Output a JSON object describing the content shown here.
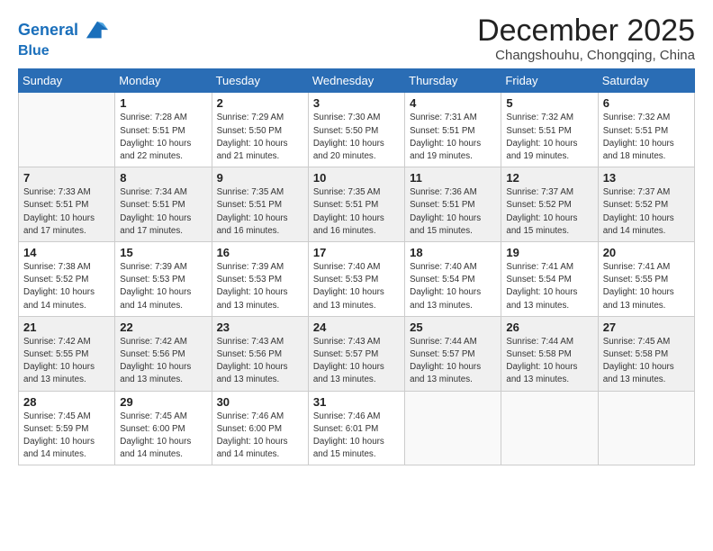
{
  "header": {
    "logo_line1": "General",
    "logo_line2": "Blue",
    "month_title": "December 2025",
    "location": "Changshouhu, Chongqing, China"
  },
  "weekdays": [
    "Sunday",
    "Monday",
    "Tuesday",
    "Wednesday",
    "Thursday",
    "Friday",
    "Saturday"
  ],
  "weeks": [
    [
      {
        "day": "",
        "sunrise": "",
        "sunset": "",
        "daylight": ""
      },
      {
        "day": "1",
        "sunrise": "Sunrise: 7:28 AM",
        "sunset": "Sunset: 5:51 PM",
        "daylight": "Daylight: 10 hours and 22 minutes."
      },
      {
        "day": "2",
        "sunrise": "Sunrise: 7:29 AM",
        "sunset": "Sunset: 5:50 PM",
        "daylight": "Daylight: 10 hours and 21 minutes."
      },
      {
        "day": "3",
        "sunrise": "Sunrise: 7:30 AM",
        "sunset": "Sunset: 5:50 PM",
        "daylight": "Daylight: 10 hours and 20 minutes."
      },
      {
        "day": "4",
        "sunrise": "Sunrise: 7:31 AM",
        "sunset": "Sunset: 5:51 PM",
        "daylight": "Daylight: 10 hours and 19 minutes."
      },
      {
        "day": "5",
        "sunrise": "Sunrise: 7:32 AM",
        "sunset": "Sunset: 5:51 PM",
        "daylight": "Daylight: 10 hours and 19 minutes."
      },
      {
        "day": "6",
        "sunrise": "Sunrise: 7:32 AM",
        "sunset": "Sunset: 5:51 PM",
        "daylight": "Daylight: 10 hours and 18 minutes."
      }
    ],
    [
      {
        "day": "7",
        "sunrise": "Sunrise: 7:33 AM",
        "sunset": "Sunset: 5:51 PM",
        "daylight": "Daylight: 10 hours and 17 minutes."
      },
      {
        "day": "8",
        "sunrise": "Sunrise: 7:34 AM",
        "sunset": "Sunset: 5:51 PM",
        "daylight": "Daylight: 10 hours and 17 minutes."
      },
      {
        "day": "9",
        "sunrise": "Sunrise: 7:35 AM",
        "sunset": "Sunset: 5:51 PM",
        "daylight": "Daylight: 10 hours and 16 minutes."
      },
      {
        "day": "10",
        "sunrise": "Sunrise: 7:35 AM",
        "sunset": "Sunset: 5:51 PM",
        "daylight": "Daylight: 10 hours and 16 minutes."
      },
      {
        "day": "11",
        "sunrise": "Sunrise: 7:36 AM",
        "sunset": "Sunset: 5:51 PM",
        "daylight": "Daylight: 10 hours and 15 minutes."
      },
      {
        "day": "12",
        "sunrise": "Sunrise: 7:37 AM",
        "sunset": "Sunset: 5:52 PM",
        "daylight": "Daylight: 10 hours and 15 minutes."
      },
      {
        "day": "13",
        "sunrise": "Sunrise: 7:37 AM",
        "sunset": "Sunset: 5:52 PM",
        "daylight": "Daylight: 10 hours and 14 minutes."
      }
    ],
    [
      {
        "day": "14",
        "sunrise": "Sunrise: 7:38 AM",
        "sunset": "Sunset: 5:52 PM",
        "daylight": "Daylight: 10 hours and 14 minutes."
      },
      {
        "day": "15",
        "sunrise": "Sunrise: 7:39 AM",
        "sunset": "Sunset: 5:53 PM",
        "daylight": "Daylight: 10 hours and 14 minutes."
      },
      {
        "day": "16",
        "sunrise": "Sunrise: 7:39 AM",
        "sunset": "Sunset: 5:53 PM",
        "daylight": "Daylight: 10 hours and 13 minutes."
      },
      {
        "day": "17",
        "sunrise": "Sunrise: 7:40 AM",
        "sunset": "Sunset: 5:53 PM",
        "daylight": "Daylight: 10 hours and 13 minutes."
      },
      {
        "day": "18",
        "sunrise": "Sunrise: 7:40 AM",
        "sunset": "Sunset: 5:54 PM",
        "daylight": "Daylight: 10 hours and 13 minutes."
      },
      {
        "day": "19",
        "sunrise": "Sunrise: 7:41 AM",
        "sunset": "Sunset: 5:54 PM",
        "daylight": "Daylight: 10 hours and 13 minutes."
      },
      {
        "day": "20",
        "sunrise": "Sunrise: 7:41 AM",
        "sunset": "Sunset: 5:55 PM",
        "daylight": "Daylight: 10 hours and 13 minutes."
      }
    ],
    [
      {
        "day": "21",
        "sunrise": "Sunrise: 7:42 AM",
        "sunset": "Sunset: 5:55 PM",
        "daylight": "Daylight: 10 hours and 13 minutes."
      },
      {
        "day": "22",
        "sunrise": "Sunrise: 7:42 AM",
        "sunset": "Sunset: 5:56 PM",
        "daylight": "Daylight: 10 hours and 13 minutes."
      },
      {
        "day": "23",
        "sunrise": "Sunrise: 7:43 AM",
        "sunset": "Sunset: 5:56 PM",
        "daylight": "Daylight: 10 hours and 13 minutes."
      },
      {
        "day": "24",
        "sunrise": "Sunrise: 7:43 AM",
        "sunset": "Sunset: 5:57 PM",
        "daylight": "Daylight: 10 hours and 13 minutes."
      },
      {
        "day": "25",
        "sunrise": "Sunrise: 7:44 AM",
        "sunset": "Sunset: 5:57 PM",
        "daylight": "Daylight: 10 hours and 13 minutes."
      },
      {
        "day": "26",
        "sunrise": "Sunrise: 7:44 AM",
        "sunset": "Sunset: 5:58 PM",
        "daylight": "Daylight: 10 hours and 13 minutes."
      },
      {
        "day": "27",
        "sunrise": "Sunrise: 7:45 AM",
        "sunset": "Sunset: 5:58 PM",
        "daylight": "Daylight: 10 hours and 13 minutes."
      }
    ],
    [
      {
        "day": "28",
        "sunrise": "Sunrise: 7:45 AM",
        "sunset": "Sunset: 5:59 PM",
        "daylight": "Daylight: 10 hours and 14 minutes."
      },
      {
        "day": "29",
        "sunrise": "Sunrise: 7:45 AM",
        "sunset": "Sunset: 6:00 PM",
        "daylight": "Daylight: 10 hours and 14 minutes."
      },
      {
        "day": "30",
        "sunrise": "Sunrise: 7:46 AM",
        "sunset": "Sunset: 6:00 PM",
        "daylight": "Daylight: 10 hours and 14 minutes."
      },
      {
        "day": "31",
        "sunrise": "Sunrise: 7:46 AM",
        "sunset": "Sunset: 6:01 PM",
        "daylight": "Daylight: 10 hours and 15 minutes."
      },
      {
        "day": "",
        "sunrise": "",
        "sunset": "",
        "daylight": ""
      },
      {
        "day": "",
        "sunrise": "",
        "sunset": "",
        "daylight": ""
      },
      {
        "day": "",
        "sunrise": "",
        "sunset": "",
        "daylight": ""
      }
    ]
  ]
}
